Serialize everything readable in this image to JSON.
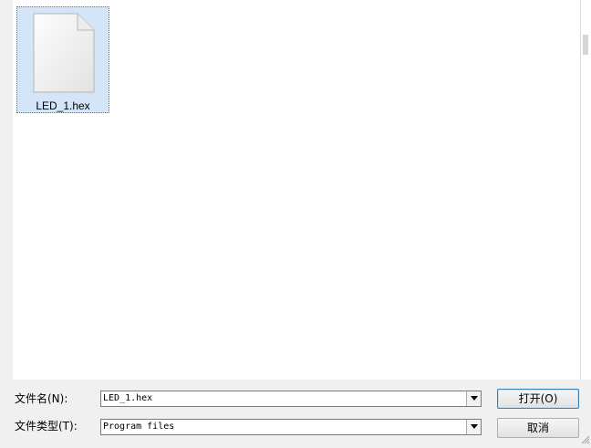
{
  "file_view": {
    "items": [
      {
        "name": "LED_1.hex",
        "selected": true,
        "icon": "document-icon"
      }
    ]
  },
  "filename_row": {
    "label": "文件名(N):",
    "value": "LED_1.hex"
  },
  "filetype_row": {
    "label": "文件类型(T):",
    "value": "Program files"
  },
  "buttons": {
    "open_label": "打开(O)",
    "cancel_label": "取消"
  },
  "colors": {
    "selection_fill": "#d5e5f8",
    "selection_border": "#3c7fb1",
    "dialog_background": "#f0f0f0"
  }
}
